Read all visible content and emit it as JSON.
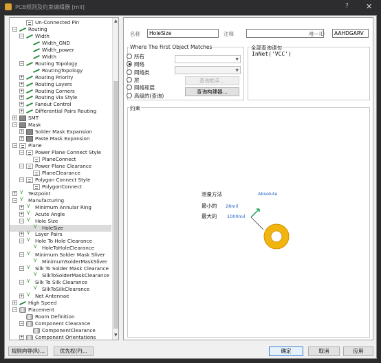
{
  "window": {
    "title": "PCB规则及约束编辑器 [mil]",
    "help": "?",
    "close": "✕"
  },
  "tree": [
    {
      "label": "Un-Connected Pin",
      "indent": 1,
      "icon": "rule",
      "exp": ""
    },
    {
      "label": "Routing",
      "indent": 0,
      "icon": "route",
      "exp": "−"
    },
    {
      "label": "Width",
      "indent": 1,
      "icon": "route",
      "exp": "−"
    },
    {
      "label": "Width_GND",
      "indent": 2,
      "icon": "route",
      "exp": ""
    },
    {
      "label": "Width_power",
      "indent": 2,
      "icon": "route",
      "exp": ""
    },
    {
      "label": "Width",
      "indent": 2,
      "icon": "route",
      "exp": ""
    },
    {
      "label": "Routing Topology",
      "indent": 1,
      "icon": "route",
      "exp": "−"
    },
    {
      "label": "RoutingTopology",
      "indent": 2,
      "icon": "route",
      "exp": ""
    },
    {
      "label": "Routing Priority",
      "indent": 1,
      "icon": "route",
      "exp": "+"
    },
    {
      "label": "Routing Layers",
      "indent": 1,
      "icon": "route",
      "exp": "+"
    },
    {
      "label": "Routing Corners",
      "indent": 1,
      "icon": "route",
      "exp": "+"
    },
    {
      "label": "Routing Via Style",
      "indent": 1,
      "icon": "route",
      "exp": "+"
    },
    {
      "label": "Fanout Control",
      "indent": 1,
      "icon": "route",
      "exp": "+"
    },
    {
      "label": "Differential Pairs Routing",
      "indent": 1,
      "icon": "route",
      "exp": "+"
    },
    {
      "label": "SMT",
      "indent": 0,
      "icon": "gray",
      "exp": "+"
    },
    {
      "label": "Mask",
      "indent": 0,
      "icon": "gray",
      "exp": "−"
    },
    {
      "label": "Solder Mask Expansion",
      "indent": 1,
      "icon": "gray",
      "exp": "+"
    },
    {
      "label": "Paste Mask Expansion",
      "indent": 1,
      "icon": "gray",
      "exp": "+"
    },
    {
      "label": "Plane",
      "indent": 0,
      "icon": "rule",
      "exp": "−"
    },
    {
      "label": "Power Plane Connect Style",
      "indent": 1,
      "icon": "rule",
      "exp": "−"
    },
    {
      "label": "PlaneConnect",
      "indent": 2,
      "icon": "rule",
      "exp": ""
    },
    {
      "label": "Power Plane Clearance",
      "indent": 1,
      "icon": "rule",
      "exp": "−"
    },
    {
      "label": "PlaneClearance",
      "indent": 2,
      "icon": "rule",
      "exp": ""
    },
    {
      "label": "Polygon Connect Style",
      "indent": 1,
      "icon": "rule",
      "exp": "−"
    },
    {
      "label": "PolygonConnect",
      "indent": 2,
      "icon": "rule",
      "exp": ""
    },
    {
      "label": "Testpoint",
      "indent": 0,
      "icon": "green",
      "exp": "+"
    },
    {
      "label": "Manufacturing",
      "indent": 0,
      "icon": "green",
      "exp": "−"
    },
    {
      "label": "Minimum Annular Ring",
      "indent": 1,
      "icon": "green",
      "exp": "+"
    },
    {
      "label": "Acute Angle",
      "indent": 1,
      "icon": "green",
      "exp": "+"
    },
    {
      "label": "Hole Size",
      "indent": 1,
      "icon": "green",
      "exp": "−"
    },
    {
      "label": "HoleSize",
      "indent": 2,
      "icon": "green",
      "exp": "",
      "selected": true
    },
    {
      "label": "Layer Pairs",
      "indent": 1,
      "icon": "green",
      "exp": "+"
    },
    {
      "label": "Hole To Hole Clearance",
      "indent": 1,
      "icon": "green",
      "exp": "−"
    },
    {
      "label": "HoleToHoleClearance",
      "indent": 2,
      "icon": "green",
      "exp": ""
    },
    {
      "label": "Minimum Solder Mask Sliver",
      "indent": 1,
      "icon": "green",
      "exp": "−"
    },
    {
      "label": "MinimumSolderMaskSliver",
      "indent": 2,
      "icon": "green",
      "exp": ""
    },
    {
      "label": "Silk To Solder Mask Clearance",
      "indent": 1,
      "icon": "green",
      "exp": "−"
    },
    {
      "label": "SilkToSolderMaskClearance",
      "indent": 2,
      "icon": "green",
      "exp": ""
    },
    {
      "label": "Silk To Silk Clearance",
      "indent": 1,
      "icon": "green",
      "exp": "−"
    },
    {
      "label": "SilkToSilkClearance",
      "indent": 2,
      "icon": "green",
      "exp": ""
    },
    {
      "label": "Net Antennae",
      "indent": 1,
      "icon": "green",
      "exp": "+"
    },
    {
      "label": "High Speed",
      "indent": 0,
      "icon": "route",
      "exp": "+"
    },
    {
      "label": "Placement",
      "indent": 0,
      "icon": "cyl",
      "exp": "−"
    },
    {
      "label": "Room Definition",
      "indent": 1,
      "icon": "cyl",
      "exp": ""
    },
    {
      "label": "Component Clearance",
      "indent": 1,
      "icon": "cyl",
      "exp": "−"
    },
    {
      "label": "ComponentClearance",
      "indent": 2,
      "icon": "cyl",
      "exp": ""
    },
    {
      "label": "Component Orientations",
      "indent": 1,
      "icon": "cyl",
      "exp": "+"
    }
  ],
  "rule": {
    "name_label": "名称",
    "name_value": "HoleSize",
    "comment_label": "注释",
    "comment_value": "",
    "uid_label": "唯一ID",
    "uid_value": "AAHDGARV"
  },
  "where": {
    "title": "Where The First Object Matches",
    "options": [
      "所有",
      "网络",
      "网络类",
      "层",
      "网络和层",
      "高级的(查询)"
    ],
    "selected_index": 1,
    "helper_button": "查询助手...",
    "builder_button": "查询构建器..."
  },
  "fullquery": {
    "title": "全部查询语句",
    "text": "InNet('VCC')"
  },
  "constraints": {
    "title": "约束",
    "method_label": "测量方法",
    "method_value": "Absolute",
    "min_label": "最小的",
    "min_value": "28mil",
    "max_label": "最大的",
    "max_value": "1000mil"
  },
  "footer": {
    "wizard": "规则向导(R)...",
    "priority": "优先权(P)...",
    "ok": "确定",
    "cancel": "取消",
    "apply": "应用"
  }
}
